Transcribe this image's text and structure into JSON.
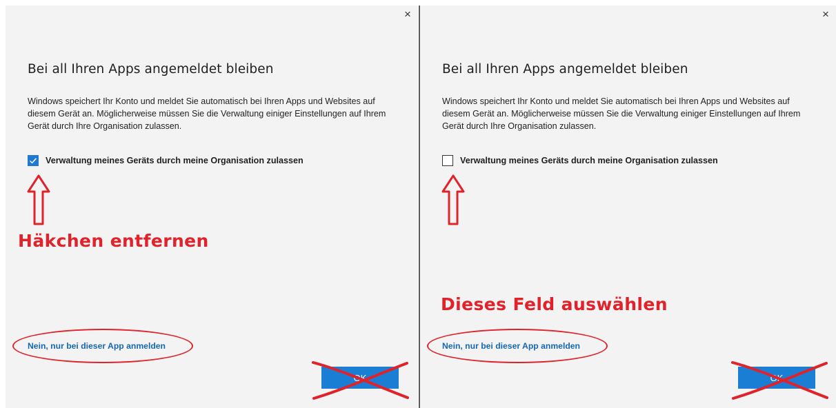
{
  "colors": {
    "dialog_bg": "#f3f3f3",
    "accent": "#1a7fd4",
    "link": "#1667b3",
    "annotation_red": "#e0232b"
  },
  "dialogs": [
    {
      "close_glyph": "×",
      "title": "Bei all Ihren Apps angemeldet bleiben",
      "description": "Windows speichert Ihr Konto und meldet Sie automatisch bei Ihren Apps und Websites auf diesem Gerät an. Möglicherweise müssen Sie die Verwaltung einiger Einstellungen auf Ihrem Gerät durch Ihre Organisation zulassen.",
      "checkbox_label": "Verwaltung meines Geräts durch meine Organisation zulassen",
      "checkbox_checked": true,
      "annotation": "Häkchen entfernen",
      "link": "Nein, nur bei dieser App anmelden",
      "ok_label": "OK"
    },
    {
      "close_glyph": "×",
      "title": "Bei all Ihren Apps angemeldet bleiben",
      "description": "Windows speichert Ihr Konto und meldet Sie automatisch bei Ihren Apps und Websites auf diesem Gerät an. Möglicherweise müssen Sie die Verwaltung einiger Einstellungen auf Ihrem Gerät durch Ihre Organisation zulassen.",
      "checkbox_label": "Verwaltung meines Geräts durch meine Organisation zulassen",
      "checkbox_checked": false,
      "annotation": "Dieses Feld auswählen",
      "link": "Nein, nur bei dieser App anmelden",
      "ok_label": "OK"
    }
  ]
}
